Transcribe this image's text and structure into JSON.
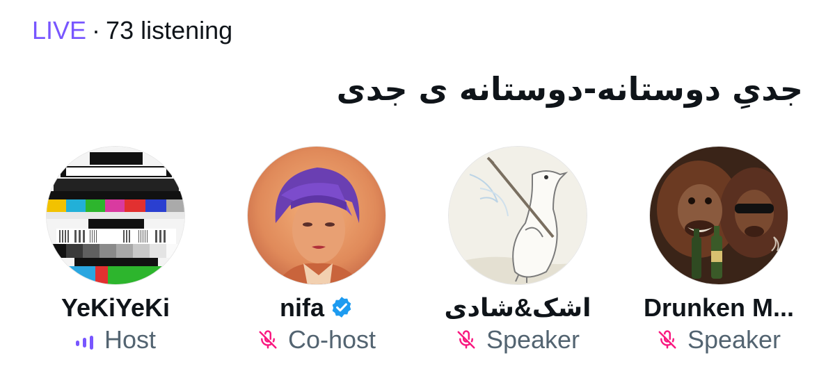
{
  "space": {
    "live_label": "LIVE",
    "separator": "·",
    "listening": "73 listening",
    "title": "جدیِ دوستانه-دوستانه ی جدی"
  },
  "colors": {
    "accent": "#7856ff",
    "muted_mic": "#f91880",
    "secondary_text": "#536471",
    "verified": "#1d9bf0"
  },
  "participants": [
    {
      "name": "YeKiYeKi",
      "role": "Host",
      "role_icon": "speaking-bars-icon"
    },
    {
      "name": "nifa",
      "role": "Co-host",
      "role_icon": "mic-muted-icon",
      "verified": true
    },
    {
      "name": "اشک&شادی",
      "role": "Speaker",
      "role_icon": "mic-muted-icon"
    },
    {
      "name": "Drunken M...",
      "role": "Speaker",
      "role_icon": "mic-muted-icon"
    }
  ]
}
